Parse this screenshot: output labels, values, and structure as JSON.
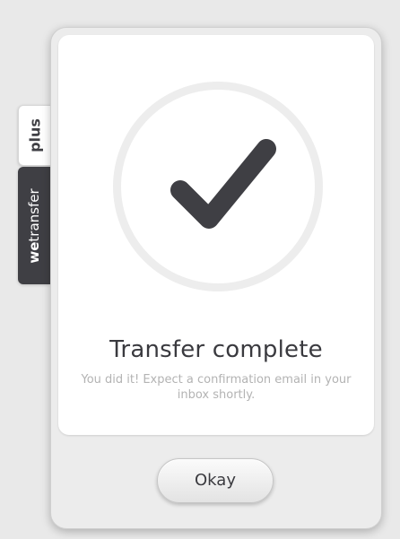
{
  "side_tabs": {
    "plus_label": "plus",
    "brand_prefix": "we",
    "brand_suffix": "transfer"
  },
  "dialog": {
    "icon": "checkmark-icon",
    "title": "Transfer complete",
    "message": "You did it! Expect a confirmation email in your inbox shortly.",
    "okay_label": "Okay"
  },
  "colors": {
    "dark": "#3f3f44",
    "circle_ring": "#ededed",
    "panel": "#ffffff",
    "background": "#e9e9e9",
    "muted_text": "#b3b3b3"
  }
}
